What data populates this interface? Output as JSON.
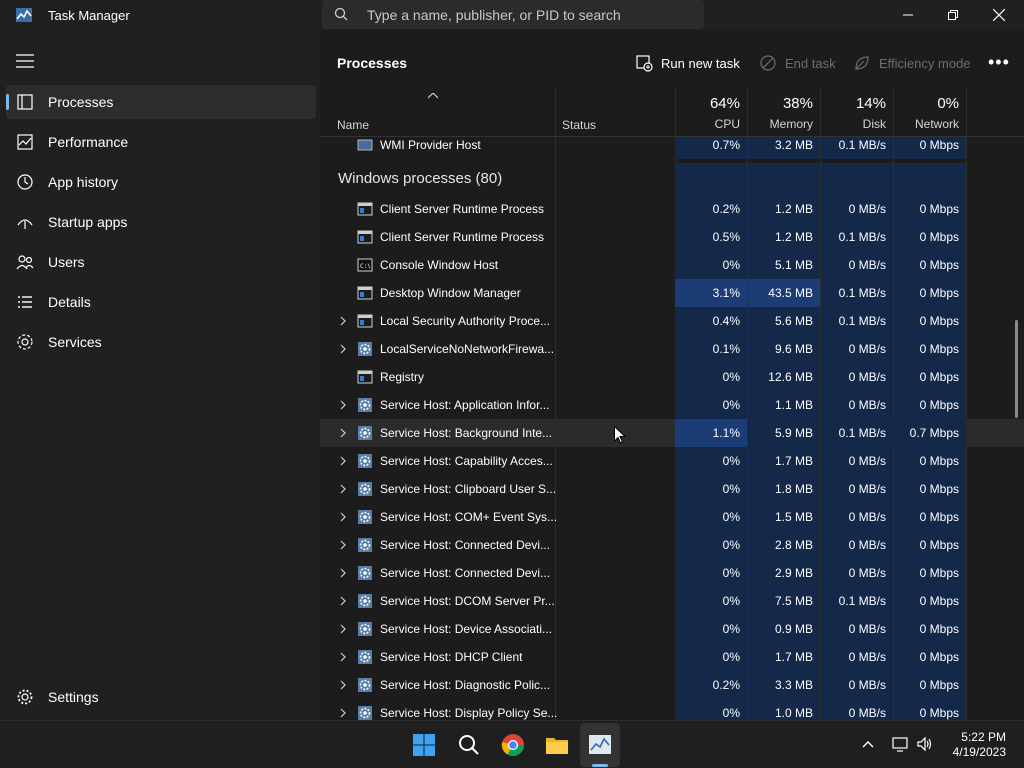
{
  "window": {
    "title": "Task Manager",
    "search_placeholder": "Type a name, publisher, or PID to search"
  },
  "sidebar": {
    "items": [
      {
        "label": "Processes",
        "icon": "processes-icon",
        "active": true
      },
      {
        "label": "Performance",
        "icon": "performance-icon"
      },
      {
        "label": "App history",
        "icon": "app-history-icon"
      },
      {
        "label": "Startup apps",
        "icon": "startup-icon"
      },
      {
        "label": "Users",
        "icon": "users-icon"
      },
      {
        "label": "Details",
        "icon": "details-icon"
      },
      {
        "label": "Services",
        "icon": "services-icon"
      }
    ],
    "settings_label": "Settings"
  },
  "toolbar": {
    "title": "Processes",
    "run_new_task": "Run new task",
    "end_task": "End task",
    "efficiency_mode": "Efficiency mode",
    "more": "•••"
  },
  "columns": {
    "name": "Name",
    "status": "Status",
    "cpu": {
      "pct": "64%",
      "label": "CPU"
    },
    "memory": {
      "pct": "38%",
      "label": "Memory"
    },
    "disk": {
      "pct": "14%",
      "label": "Disk"
    },
    "network": {
      "pct": "0%",
      "label": "Network"
    }
  },
  "group_title": "Windows processes (80)",
  "top_row": {
    "name": "WMI Provider Host",
    "cpu": "0.7%",
    "mem": "3.2 MB",
    "disk": "0.1 MB/s",
    "net": "0 Mbps"
  },
  "rows": [
    {
      "name": "Client Server Runtime Process",
      "cpu": "0.2%",
      "mem": "1.2 MB",
      "disk": "0 MB/s",
      "net": "0 Mbps",
      "expand": false,
      "icon": "window-icon"
    },
    {
      "name": "Client Server Runtime Process",
      "cpu": "0.5%",
      "mem": "1.2 MB",
      "disk": "0.1 MB/s",
      "net": "0 Mbps",
      "expand": false,
      "icon": "window-icon"
    },
    {
      "name": "Console Window Host",
      "cpu": "0%",
      "mem": "5.1 MB",
      "disk": "0 MB/s",
      "net": "0 Mbps",
      "expand": false,
      "icon": "console-icon"
    },
    {
      "name": "Desktop Window Manager",
      "cpu": "3.1%",
      "mem": "43.5 MB",
      "disk": "0.1 MB/s",
      "net": "0 Mbps",
      "expand": false,
      "icon": "window-icon",
      "hi": true
    },
    {
      "name": "Local Security Authority Proce...",
      "cpu": "0.4%",
      "mem": "5.6 MB",
      "disk": "0.1 MB/s",
      "net": "0 Mbps",
      "expand": true,
      "icon": "window-icon"
    },
    {
      "name": "LocalServiceNoNetworkFirewa...",
      "cpu": "0.1%",
      "mem": "9.6 MB",
      "disk": "0 MB/s",
      "net": "0 Mbps",
      "expand": true,
      "icon": "gear-icon"
    },
    {
      "name": "Registry",
      "cpu": "0%",
      "mem": "12.6 MB",
      "disk": "0 MB/s",
      "net": "0 Mbps",
      "expand": false,
      "icon": "window-icon"
    },
    {
      "name": "Service Host: Application Infor...",
      "cpu": "0%",
      "mem": "1.1 MB",
      "disk": "0 MB/s",
      "net": "0 Mbps",
      "expand": true,
      "icon": "gear-icon"
    },
    {
      "name": "Service Host: Background Inte...",
      "cpu": "1.1%",
      "mem": "5.9 MB",
      "disk": "0.1 MB/s",
      "net": "0.7 Mbps",
      "expand": true,
      "icon": "gear-icon",
      "hover": true
    },
    {
      "name": "Service Host: Capability Acces...",
      "cpu": "0%",
      "mem": "1.7 MB",
      "disk": "0 MB/s",
      "net": "0 Mbps",
      "expand": true,
      "icon": "gear-icon"
    },
    {
      "name": "Service Host: Clipboard User S...",
      "cpu": "0%",
      "mem": "1.8 MB",
      "disk": "0 MB/s",
      "net": "0 Mbps",
      "expand": true,
      "icon": "gear-icon"
    },
    {
      "name": "Service Host: COM+ Event Sys...",
      "cpu": "0%",
      "mem": "1.5 MB",
      "disk": "0 MB/s",
      "net": "0 Mbps",
      "expand": true,
      "icon": "gear-icon"
    },
    {
      "name": "Service Host: Connected Devi...",
      "cpu": "0%",
      "mem": "2.8 MB",
      "disk": "0 MB/s",
      "net": "0 Mbps",
      "expand": true,
      "icon": "gear-icon"
    },
    {
      "name": "Service Host: Connected Devi...",
      "cpu": "0%",
      "mem": "2.9 MB",
      "disk": "0 MB/s",
      "net": "0 Mbps",
      "expand": true,
      "icon": "gear-icon"
    },
    {
      "name": "Service Host: DCOM Server Pr...",
      "cpu": "0%",
      "mem": "7.5 MB",
      "disk": "0.1 MB/s",
      "net": "0 Mbps",
      "expand": true,
      "icon": "gear-icon"
    },
    {
      "name": "Service Host: Device Associati...",
      "cpu": "0%",
      "mem": "0.9 MB",
      "disk": "0 MB/s",
      "net": "0 Mbps",
      "expand": true,
      "icon": "gear-icon"
    },
    {
      "name": "Service Host: DHCP Client",
      "cpu": "0%",
      "mem": "1.7 MB",
      "disk": "0 MB/s",
      "net": "0 Mbps",
      "expand": true,
      "icon": "gear-icon"
    },
    {
      "name": "Service Host: Diagnostic Polic...",
      "cpu": "0.2%",
      "mem": "3.3 MB",
      "disk": "0 MB/s",
      "net": "0 Mbps",
      "expand": true,
      "icon": "gear-icon"
    },
    {
      "name": "Service Host: Display Policy Se...",
      "cpu": "0%",
      "mem": "1.0 MB",
      "disk": "0 MB/s",
      "net": "0 Mbps",
      "expand": true,
      "icon": "gear-icon"
    }
  ],
  "taskbar": {
    "time": "5:22 PM",
    "date": "4/19/2023"
  },
  "colors": {
    "accent": "#76b9ed",
    "cell_bg": "#14284a",
    "cell_hi": "#1b3c74"
  }
}
